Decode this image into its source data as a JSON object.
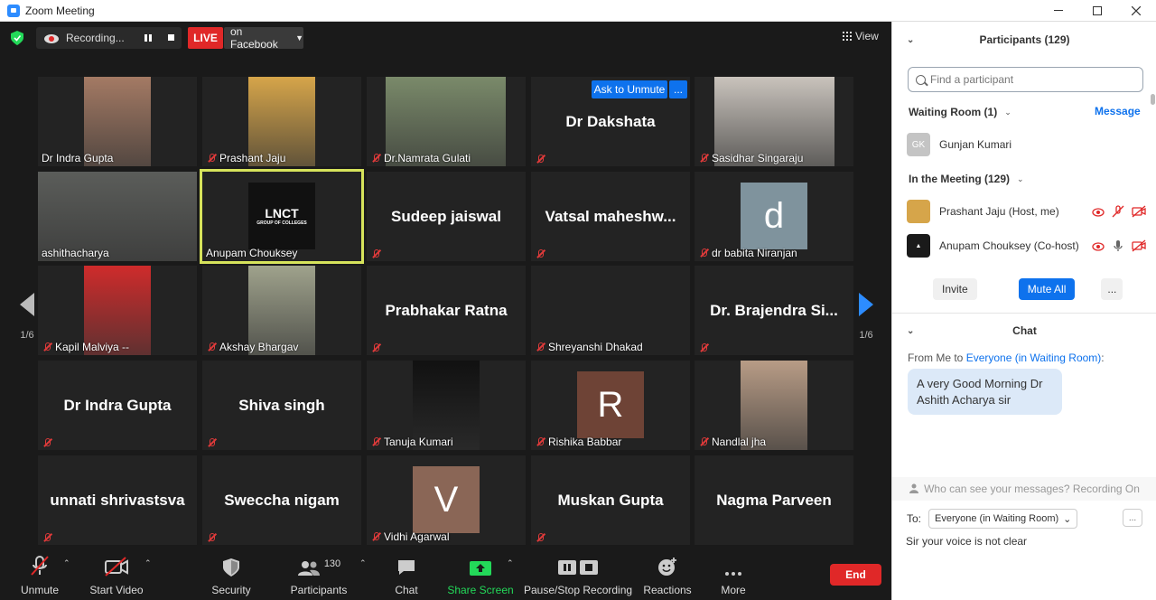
{
  "window": {
    "title": "Zoom Meeting"
  },
  "topbar": {
    "recording_label": "Recording...",
    "live_label": "LIVE",
    "stream_label": "on Facebook",
    "view_label": "View"
  },
  "tiles": [
    {
      "name": "Dr Indra Gupta",
      "muted": false,
      "kind": "photo",
      "photo_color": "#a47a64"
    },
    {
      "name": "Prashant Jaju",
      "muted": true,
      "kind": "photo",
      "photo_color": "#d6a54a"
    },
    {
      "name": "Dr.Namrata Gulati",
      "muted": true,
      "kind": "photo",
      "photo_color": "#7a8a6a"
    },
    {
      "name": "Dr Dakshata",
      "muted": true,
      "kind": "text",
      "ask_label": "Ask to Unmute",
      "more_label": "..."
    },
    {
      "name": "Sasidhar Singaraju",
      "muted": true,
      "kind": "photo",
      "photo_color": "#c9c3bc"
    },
    {
      "name": "ashithacharya",
      "muted": false,
      "kind": "photo",
      "photo_color": "#5b5d5a"
    },
    {
      "name": "Anupam Chouksey",
      "muted": false,
      "kind": "logo",
      "logo_text": "LNCT",
      "logo_sub": "GROUP OF COLLEGES",
      "active": true
    },
    {
      "name": "Sudeep jaiswal",
      "muted": true,
      "kind": "text"
    },
    {
      "name": "Vatsal  maheshw...",
      "muted": true,
      "kind": "text"
    },
    {
      "name": "dr babita Niranjan",
      "muted": true,
      "kind": "avatar",
      "letter": "d",
      "avatar_color": "#7f939d"
    },
    {
      "name": "Kapil Malviya --",
      "muted": true,
      "kind": "photo",
      "photo_color": "#cf2b2b"
    },
    {
      "name": "Akshay Bhargav",
      "muted": true,
      "kind": "photo",
      "photo_color": "#9fa28c"
    },
    {
      "name": "Prabhakar Ratna",
      "muted": true,
      "kind": "text"
    },
    {
      "name": "Shreyanshi Dhakad",
      "muted": true,
      "kind": "blank"
    },
    {
      "name": "Dr. Brajendra Si...",
      "muted": true,
      "kind": "text"
    },
    {
      "name": "Dr Indra Gupta",
      "muted": true,
      "kind": "text"
    },
    {
      "name": "Shiva singh",
      "muted": true,
      "kind": "text"
    },
    {
      "name": "Tanuja Kumari",
      "muted": true,
      "kind": "photo",
      "photo_color": "#111111"
    },
    {
      "name": "Rishika Babbar",
      "muted": true,
      "kind": "avatar",
      "letter": "R",
      "avatar_color": "#6e4336"
    },
    {
      "name": "Nandlal jha",
      "muted": true,
      "kind": "photo",
      "photo_color": "#b89c86"
    },
    {
      "name": "unnati shrivastsva",
      "muted": true,
      "kind": "text"
    },
    {
      "name": "Sweccha nigam",
      "muted": true,
      "kind": "text"
    },
    {
      "name": "Vidhi Agarwal",
      "muted": true,
      "kind": "avatar",
      "letter": "V",
      "avatar_color": "#8a6656"
    },
    {
      "name": "Muskan Gupta",
      "muted": true,
      "kind": "text"
    },
    {
      "name": "Nagma Parveen",
      "muted": false,
      "kind": "text"
    }
  ],
  "nav": {
    "page_left": "1/6",
    "page_right": "1/6"
  },
  "toolbar": {
    "unmute": "Unmute",
    "start_video": "Start Video",
    "security": "Security",
    "participants": "Participants",
    "participants_count": "130",
    "chat": "Chat",
    "share_screen": "Share Screen",
    "pause_recording": "Pause/Stop Recording",
    "reactions": "Reactions",
    "more": "More",
    "end": "End"
  },
  "participants_panel": {
    "title": "Participants (129)",
    "search_placeholder": "Find a participant",
    "waiting_room_label": "Waiting Room (1)",
    "message_label": "Message",
    "waiting": [
      {
        "initials": "GK",
        "name": "Gunjan Kumari"
      }
    ],
    "in_meeting_label": "In the Meeting (129)",
    "members": [
      {
        "name": "Prashant Jaju (Host, me)",
        "avatar_color": "#d6a54a"
      },
      {
        "name": "Anupam Chouksey (Co-host)",
        "avatar_color": "#1a1a1a"
      }
    ],
    "invite_label": "Invite",
    "mute_all_label": "Mute All",
    "more_label": "..."
  },
  "chat_panel": {
    "title": "Chat",
    "from_prefix": "From Me to ",
    "to_target": "Everyone (in Waiting Room)",
    "from_suffix": ":",
    "message": "A very Good Morning Dr Ashith Acharya sir",
    "privacy_note": "Who can see your messages? Recording On",
    "to_label": "To:",
    "to_select": "Everyone (in Waiting Room)",
    "more_label": "...",
    "composer_text": "Sir your voice is not clear"
  }
}
